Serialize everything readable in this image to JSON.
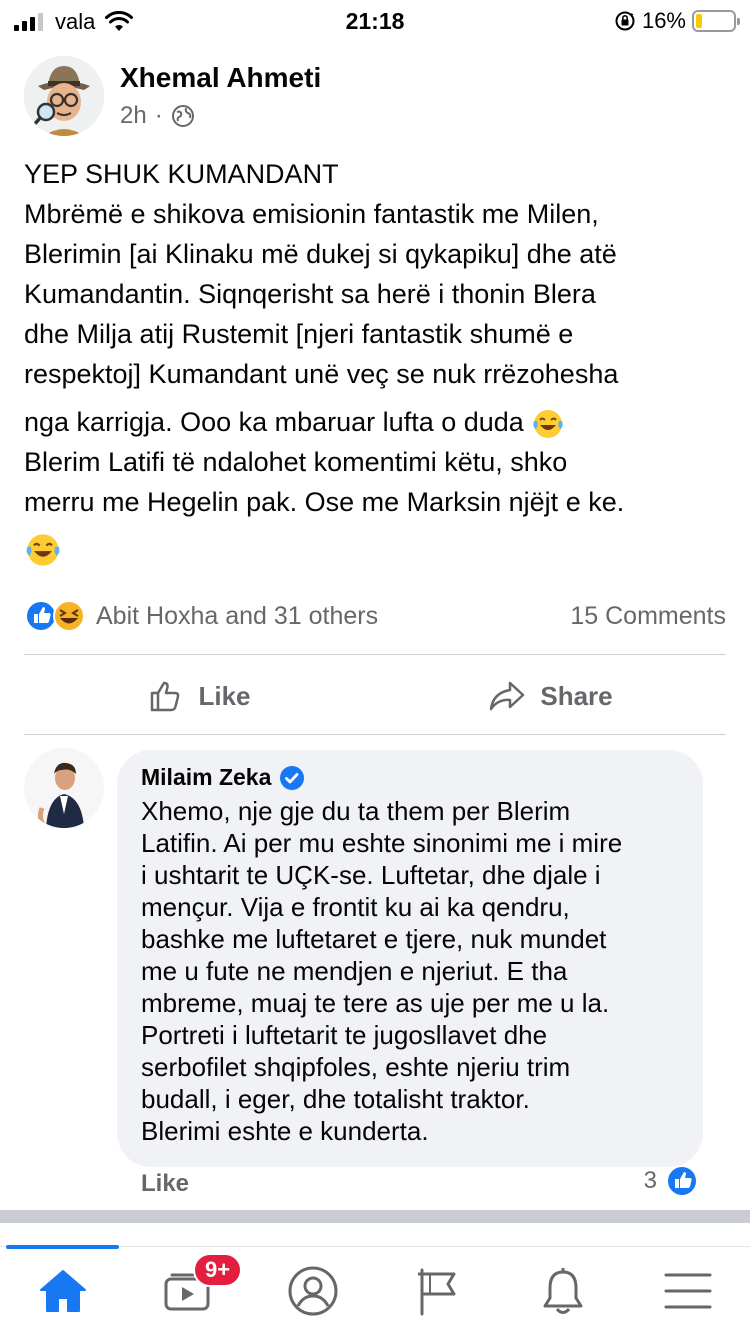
{
  "status_bar": {
    "carrier": "vala",
    "time": "21:18",
    "battery_percent": "16%",
    "battery_level": 0.16,
    "icons": [
      "signal-icon",
      "wifi-icon",
      "rotation-lock-icon",
      "battery-icon"
    ]
  },
  "post": {
    "author": "Xhemal Ahmeti",
    "time_ago": "2h",
    "separator": "·",
    "privacy_icon": "globe-icon",
    "body_lines": [
      "YEP SHUK KUMANDANT",
      "Mbrëmë e shikova emisionin fantastik me Milen,",
      "Blerimin [ai Klinaku më dukej si qykapiku] dhe atë",
      "Kumandantin. Siqnqerisht sa herë i thonin Blera",
      "dhe Milja atij Rustemit [njeri fantastik shumë e",
      "respektoj] Kumandant unë veç se nuk rrëzohesha"
    ],
    "body_line7": "nga karrigja. Ooo ka mbaruar lufta o duda",
    "body_lines_after": [
      "Blerim Latifi të ndalohet komentimi këtu, shko",
      "merru me Hegelin pak. Ose me Marksin njëjt e ke."
    ],
    "emoji": "laughing-tears-emoji",
    "reactions_text": "Abit Hoxha and 31 others",
    "reaction_icons": [
      "like-reaction-icon",
      "haha-reaction-icon"
    ],
    "comments_text": "15 Comments",
    "actions": {
      "like": "Like",
      "share": "Share"
    }
  },
  "comment": {
    "author": "Milaim Zeka",
    "verified_icon": "verified-badge-icon",
    "lines": [
      "Xhemo, nje gje du ta them per Blerim",
      "Latifin. Ai per mu eshte sinonimi me i mire",
      "i ushtarit te UÇK-se. Luftetar, dhe djale i",
      "mençur. Vija e frontit ku ai ka qendru,",
      "bashke me luftetaret e tjere, nuk mundet",
      "me u fute ne mendjen e njeriut. E tha",
      "mbreme, muaj te tere as uje per me u la.",
      "Portreti i luftetarit te jugosllavet dhe",
      "serbofilet shqipfoles, eshte njeriu trim",
      "budall, i eger, dhe totalisht traktor.",
      "Blerimi eshte e kunderta."
    ],
    "like_label": "Like",
    "reaction_count": "3"
  },
  "bottom_nav": {
    "items": [
      "home-icon",
      "watch-icon",
      "profile-icon",
      "pages-flag-icon",
      "notifications-bell-icon",
      "menu-icon"
    ],
    "watch_badge": "9+",
    "active": "home-icon"
  },
  "colors": {
    "facebook_blue": "#1877f2",
    "secondary_text": "#65676b",
    "bubble_bg": "#f0f2f5",
    "badge_red": "#e41e3f"
  }
}
